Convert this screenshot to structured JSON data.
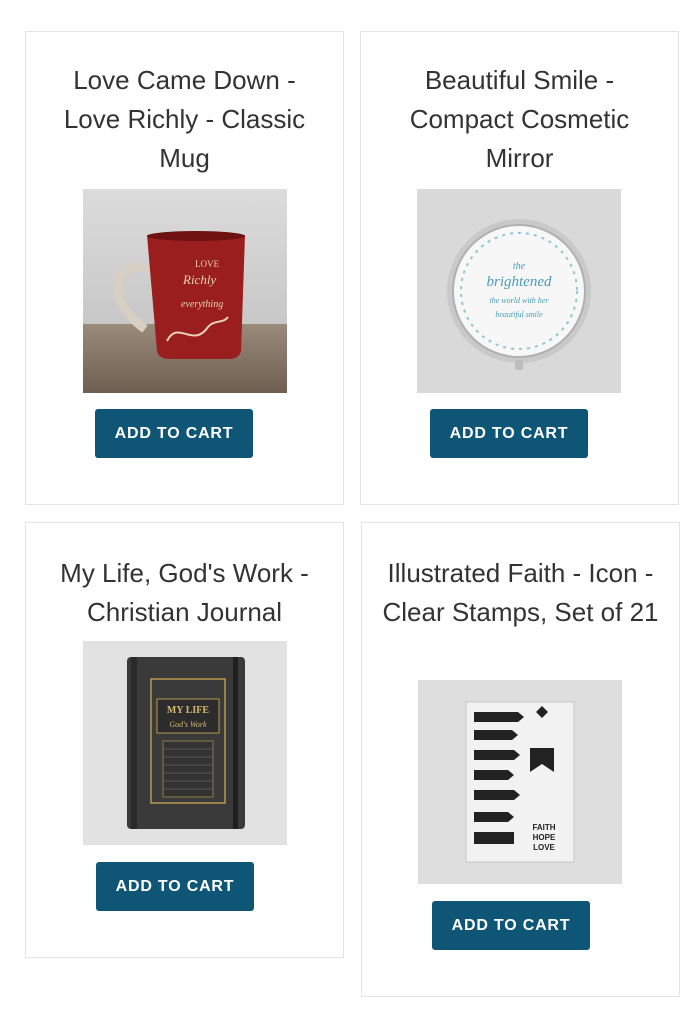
{
  "products": [
    {
      "title": "Love Came Down - Love Richly - Classic Mug",
      "button_label": "ADD TO CART",
      "image_text": [
        "LOVE",
        "Richly",
        "everything"
      ]
    },
    {
      "title": "Beautiful Smile - Compact Cosmetic Mirror",
      "button_label": "ADD TO CART",
      "image_text": [
        "the",
        "brightened",
        "the world with her",
        "beautiful smile"
      ]
    },
    {
      "title": "My Life, God's Work - Christian Journal",
      "button_label": "ADD TO CART",
      "image_text": [
        "MY LIFE",
        "God's Work"
      ]
    },
    {
      "title": "Illustrated Faith - Icon - Clear Stamps, Set of 21",
      "button_label": "ADD TO CART",
      "image_text": [
        "FAITH",
        "HOPE",
        "LOVE"
      ]
    }
  ],
  "colors": {
    "button_bg": "#0f5676",
    "button_text": "#ffffff",
    "title": "#333333",
    "card_border": "#e4e4e4"
  }
}
